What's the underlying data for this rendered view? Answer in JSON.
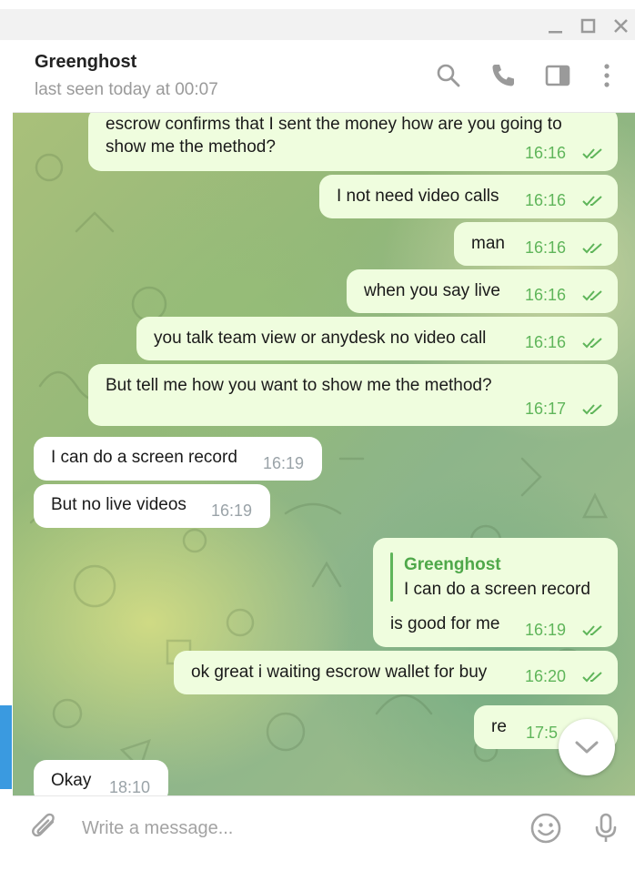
{
  "window": {
    "controls": [
      {
        "name": "minimize-icon"
      },
      {
        "name": "maximize-icon"
      },
      {
        "name": "close-icon"
      }
    ]
  },
  "header": {
    "peer_name": "Greenghost",
    "status": "last seen today at 00:07",
    "icons": [
      "search-icon",
      "phone-icon",
      "sidebar-toggle-icon",
      "more-vertical-icon"
    ]
  },
  "messages": [
    {
      "dir": "out",
      "text_lines": [
        "escrow confirms that I sent the money how are you going to",
        "show me the method?"
      ],
      "time": "16:16",
      "read": true
    },
    {
      "dir": "out",
      "text": "I not need video calls",
      "time": "16:16",
      "read": true
    },
    {
      "dir": "out",
      "text": "man",
      "time": "16:16",
      "read": true
    },
    {
      "dir": "out",
      "text": "when you say live",
      "time": "16:16",
      "read": true
    },
    {
      "dir": "out",
      "text": "you talk team view or anydesk no video call",
      "time": "16:16",
      "read": true
    },
    {
      "dir": "out",
      "text": "But tell me how you want to show me the method?",
      "time": "16:17",
      "read": true
    },
    {
      "dir": "in",
      "text": "I can do a screen record",
      "time": "16:19"
    },
    {
      "dir": "in",
      "text": "But no live videos",
      "time": "16:19"
    },
    {
      "dir": "out",
      "reply_to": {
        "name": "Greenghost",
        "text": "I can do a screen record"
      },
      "text": "is good for me",
      "time": "16:19",
      "read": true
    },
    {
      "dir": "out",
      "text": "ok great i waiting escrow wallet for buy",
      "time": "16:20",
      "read": true
    },
    {
      "dir": "out",
      "text": "re",
      "time": "17:5",
      "read": true
    },
    {
      "dir": "in",
      "text": "Okay",
      "time": "18:10"
    }
  ],
  "composer": {
    "placeholder": "Write a message...",
    "icons": [
      "attach-icon",
      "emoji-icon",
      "microphone-icon"
    ]
  },
  "colors": {
    "outgoing_bubble": "#effdde",
    "incoming_bubble": "#ffffff",
    "check_green": "#5fb55a",
    "accent_blue": "#3a9ae0"
  }
}
